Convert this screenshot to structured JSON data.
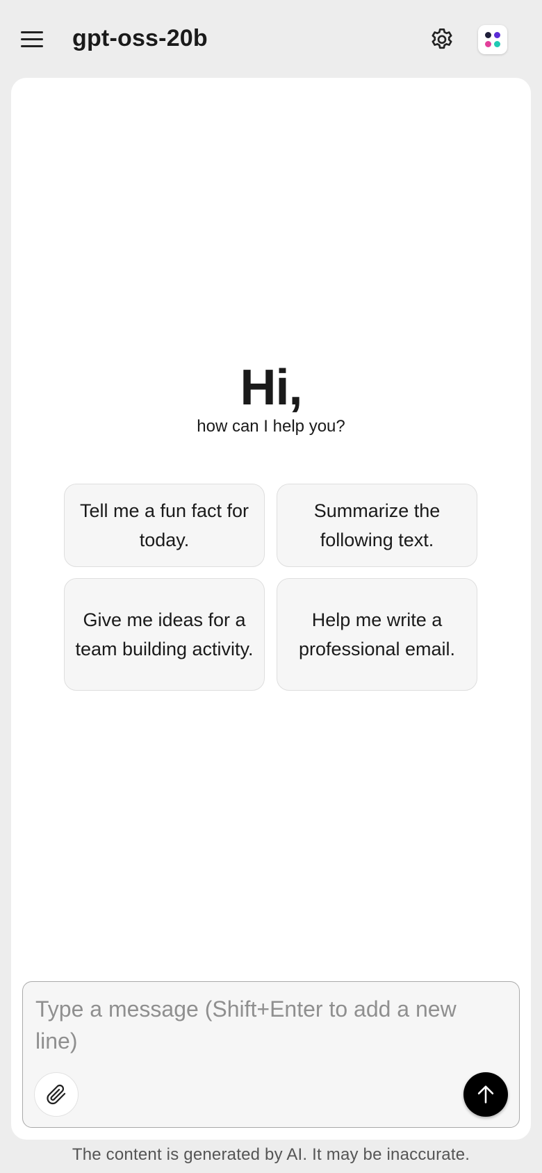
{
  "header": {
    "title": "gpt-oss-20b",
    "menu_icon": "hamburger-menu-icon",
    "settings_icon": "gear-icon",
    "app_icon": "app-logo-icon",
    "logo_dot_colors": [
      "#1f1f3a",
      "#5b2bd6",
      "#e23f9a",
      "#22c9b3"
    ]
  },
  "greeting": {
    "title": "Hi,",
    "subtitle": "how can I help you?"
  },
  "suggestions": [
    {
      "label": "Tell me a fun fact for today."
    },
    {
      "label": "Summarize the following text."
    },
    {
      "label": "Give me ideas for a team building activity."
    },
    {
      "label": "Help me write a professional email."
    }
  ],
  "composer": {
    "placeholder": "Type a message (Shift+Enter to add a new line)",
    "value": "",
    "attach_icon": "paperclip-icon",
    "send_icon": "arrow-up-icon"
  },
  "footer": {
    "disclaimer": "The content is generated by AI. It may be inaccurate."
  },
  "colors": {
    "background": "#ededed",
    "card": "#ffffff",
    "send_button": "#000000"
  }
}
